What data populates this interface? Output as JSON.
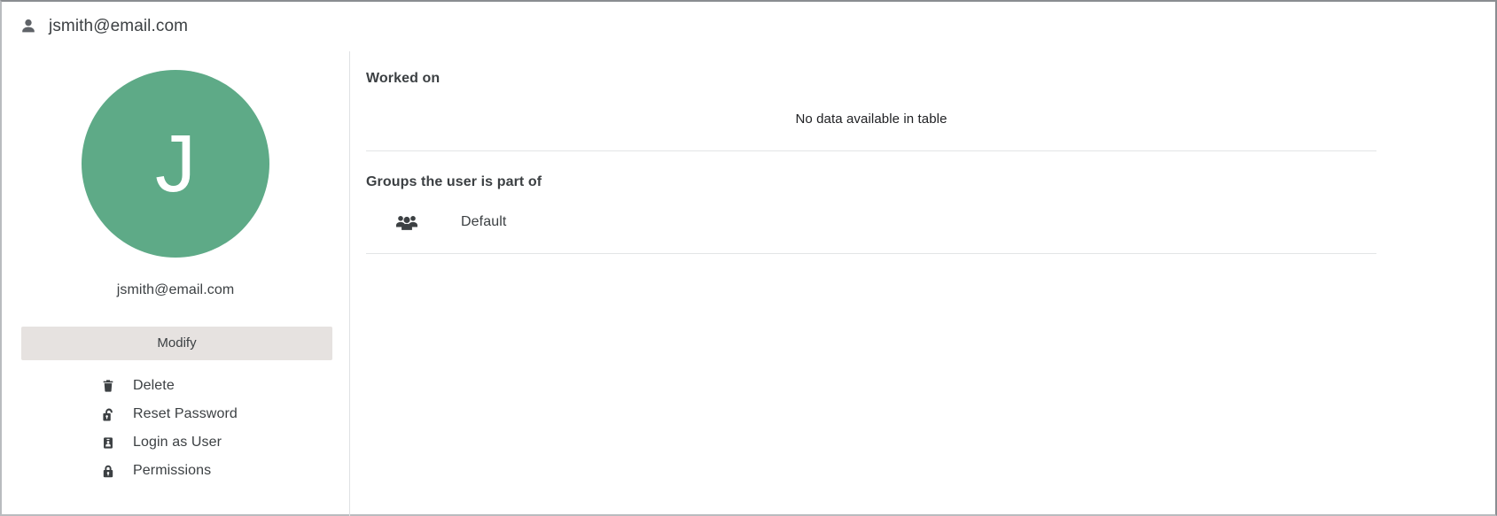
{
  "header": {
    "icon": "person-icon",
    "title": "jsmith@email.com"
  },
  "profile": {
    "avatar_initial": "J",
    "avatar_color": "#5eaa87",
    "avatar_text_color": "#ffffff",
    "email": "jsmith@email.com",
    "modify_label": "Modify",
    "modify_bg": "#e6e2e0",
    "actions": [
      {
        "icon": "trash-icon",
        "label": "Delete"
      },
      {
        "icon": "unlock-icon",
        "label": "Reset Password"
      },
      {
        "icon": "id-badge-icon",
        "label": "Login as User"
      },
      {
        "icon": "lock-icon",
        "label": "Permissions"
      }
    ]
  },
  "worked_on": {
    "title": "Worked on",
    "empty_message": "No data available in table"
  },
  "groups": {
    "title": "Groups the user is part of",
    "items": [
      {
        "icon": "group-people-icon",
        "label": "Default"
      }
    ]
  }
}
